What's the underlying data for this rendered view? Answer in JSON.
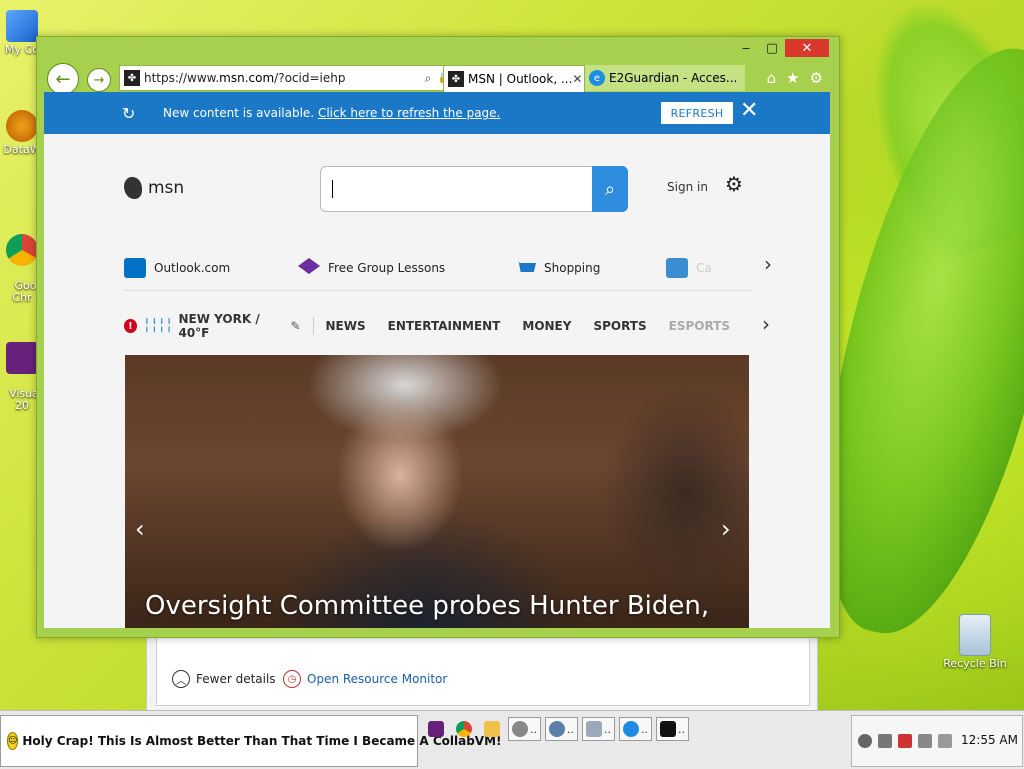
{
  "desktop": {
    "icons": [
      {
        "label": "My Co"
      },
      {
        "label": "DataW"
      },
      {
        "label": "Goo\nChr"
      },
      {
        "label": "Visual\n20"
      },
      {
        "label": "Recycle Bin"
      }
    ]
  },
  "task_manager": {
    "fewer_details": "Fewer details",
    "open_resource_monitor": "Open Resource Monitor"
  },
  "browser": {
    "window_controls": {
      "minimize": "‒",
      "maximize": "▢",
      "close": "✕"
    },
    "address": {
      "prefix": "https://www.",
      "domain": "msn.com",
      "suffix": "/?ocid=iehp",
      "search_glyph": "⌕",
      "lock_glyph": "🔒",
      "refresh_glyph": "↻"
    },
    "tabs": [
      {
        "label": "MSN | Outlook, ...",
        "active": true,
        "close": "✕"
      },
      {
        "label": "E2Guardian - Acces...",
        "active": false
      }
    ],
    "toolbar_icons": {
      "home": "⌂",
      "favorites": "★",
      "tools": "⚙"
    }
  },
  "msn": {
    "banner": {
      "message": "New content is available. ",
      "link": "Click here to refresh the page.",
      "button": "REFRESH",
      "close": "✕"
    },
    "logo_text": "msn",
    "search": {
      "button_glyph": "⌕",
      "value": ""
    },
    "sign_in": "Sign in",
    "quick_links": [
      {
        "label": "Outlook.com",
        "color": "#0072c6"
      },
      {
        "label": "Free Group Lessons",
        "color": "#6b2fa0"
      },
      {
        "label": "Shopping",
        "color": "#1a78c6"
      },
      {
        "label": "Ca",
        "color": "#3b8ed1"
      }
    ],
    "weather": {
      "location": "NEW YORK / 40°F"
    },
    "nav": [
      "NEWS",
      "ENTERTAINMENT",
      "MONEY",
      "SPORTS",
      "ESPORTS"
    ],
    "hero": {
      "caption": "Oversight Committee probes Hunter Biden,"
    }
  },
  "taskbar": {
    "message": "Holy Crap! This Is Almost Better Than That Time I Became A CollabVM!",
    "clock": "12:55 AM"
  }
}
